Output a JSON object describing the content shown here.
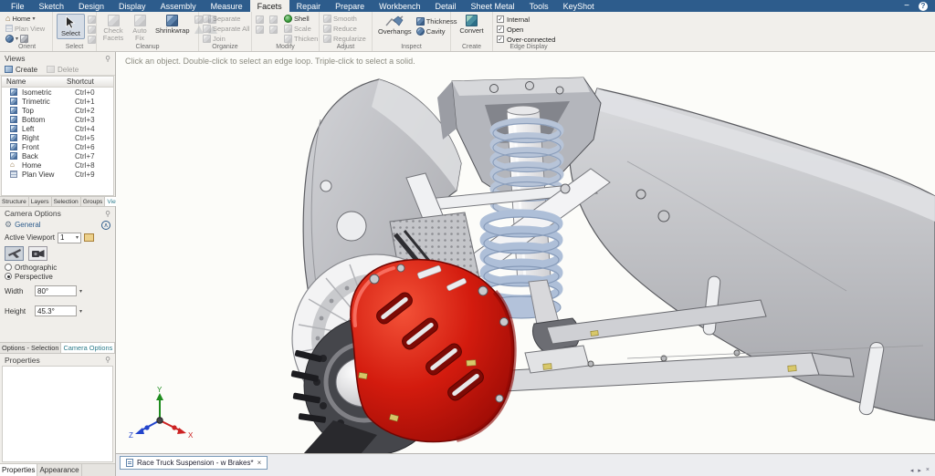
{
  "menubar": {
    "tabs": [
      {
        "label": "File"
      },
      {
        "label": "Sketch"
      },
      {
        "label": "Design"
      },
      {
        "label": "Display"
      },
      {
        "label": "Assembly"
      },
      {
        "label": "Measure"
      },
      {
        "label": "Facets",
        "active": true
      },
      {
        "label": "Repair"
      },
      {
        "label": "Prepare"
      },
      {
        "label": "Workbench"
      },
      {
        "label": "Detail"
      },
      {
        "label": "Sheet Metal"
      },
      {
        "label": "Tools"
      },
      {
        "label": "KeyShot"
      }
    ]
  },
  "icons": {
    "home": "⌂",
    "dropdown": "▾",
    "check": "✓",
    "gear": "⚙",
    "collapse": "∧",
    "pin": "⚲",
    "minimize": "−",
    "help": "?",
    "close": "×",
    "nav_prev": "◂",
    "nav_next": "▸"
  },
  "ribbon": {
    "orient": {
      "label": "Orient",
      "home": "Home",
      "plan_view": "Plan View"
    },
    "select": {
      "label": "Select",
      "button": "Select"
    },
    "cleanup": {
      "label": "Cleanup",
      "check_facets": "Check Facets",
      "auto_fix": "Auto Fix",
      "shrinkwrap": "Shrinkwrap"
    },
    "organize": {
      "label": "Organize",
      "separate": "Separate",
      "separate_all": "Separate All",
      "join": "Join"
    },
    "modify": {
      "label": "Modify",
      "shell": "Shell",
      "scale": "Scale",
      "thicken": "Thicken"
    },
    "adjust": {
      "label": "Adjust",
      "smooth": "Smooth",
      "reduce": "Reduce",
      "regularize": "Regularize"
    },
    "inspect": {
      "label": "Inspect",
      "overhangs": "Overhangs",
      "thickness": "Thickness",
      "cavity": "Cavity"
    },
    "create": {
      "label": "Create",
      "convert": "Convert"
    },
    "edge_display": {
      "label": "Edge Display",
      "internal": "Internal",
      "open": "Open",
      "over_connected": "Over-connected"
    }
  },
  "views_panel": {
    "title": "Views",
    "create": "Create",
    "delete": "Delete",
    "col_name": "Name",
    "col_shortcut": "Shortcut",
    "rows": [
      {
        "name": "Isometric",
        "shortcut": "Ctrl+0"
      },
      {
        "name": "Trimetric",
        "shortcut": "Ctrl+1"
      },
      {
        "name": "Top",
        "shortcut": "Ctrl+2"
      },
      {
        "name": "Bottom",
        "shortcut": "Ctrl+3"
      },
      {
        "name": "Left",
        "shortcut": "Ctrl+4"
      },
      {
        "name": "Right",
        "shortcut": "Ctrl+5"
      },
      {
        "name": "Front",
        "shortcut": "Ctrl+6"
      },
      {
        "name": "Back",
        "shortcut": "Ctrl+7"
      },
      {
        "name": "Home",
        "shortcut": "Ctrl+8"
      },
      {
        "name": "Plan View",
        "shortcut": "Ctrl+9"
      }
    ]
  },
  "panel_tabs": {
    "structure": "Structure",
    "layers": "Layers",
    "selection": "Selection",
    "groups": "Groups",
    "views": "Views"
  },
  "camera_options": {
    "title": "Camera Options",
    "general": "General",
    "active_viewport_label": "Active Viewport",
    "active_viewport_value": "1",
    "orthographic": "Orthographic",
    "perspective": "Perspective",
    "width_label": "Width",
    "width_value": "80°",
    "height_label": "Height",
    "height_value": "45.3°"
  },
  "lower_tabs": {
    "options_selection": "Options - Selection",
    "camera_options": "Camera Options"
  },
  "properties_panel": {
    "title": "Properties"
  },
  "bottom_tabs": {
    "properties": "Properties",
    "appearance": "Appearance"
  },
  "viewport": {
    "hint": "Click an object. Double-click to select an edge loop. Triple-click to select a solid.",
    "axis_x": "X",
    "axis_y": "Y",
    "axis_z": "Z"
  },
  "document_tabs": {
    "active": "Race Truck Suspension - w Brakes*"
  },
  "colors": {
    "menubar_blue": "#2d5c8c",
    "caliper_red": "#d31b0e",
    "spring_blue": "#b7c4d8",
    "shell_green": "#3d9e3d",
    "active_tab_teal": "#2e7d8c"
  }
}
